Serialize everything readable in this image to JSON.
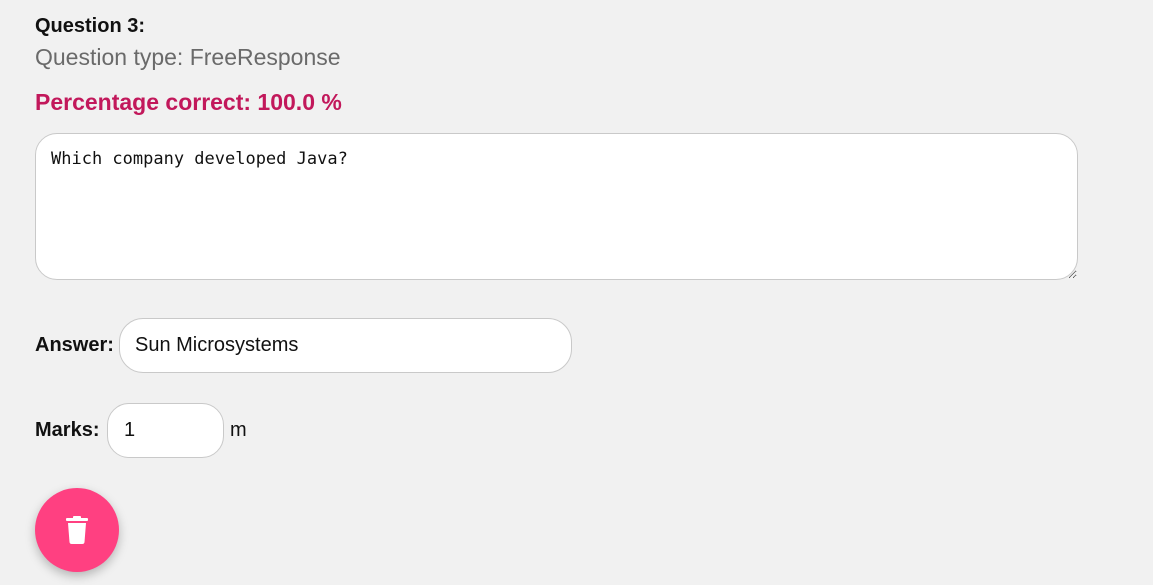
{
  "question": {
    "title": "Question 3:",
    "type_text": "Question type: FreeResponse",
    "percentage_text": "Percentage correct: 100.0 %",
    "text": "Which company developed Java?"
  },
  "answer": {
    "label": "Answer:",
    "value": "Sun Microsystems"
  },
  "marks": {
    "label": "Marks:",
    "value": "1",
    "unit": "m"
  },
  "delete_button": {
    "icon": "trash-icon"
  },
  "colors": {
    "background": "#f1f1f1",
    "percentage": "#c2185b",
    "delete_button": "#ff4081"
  }
}
